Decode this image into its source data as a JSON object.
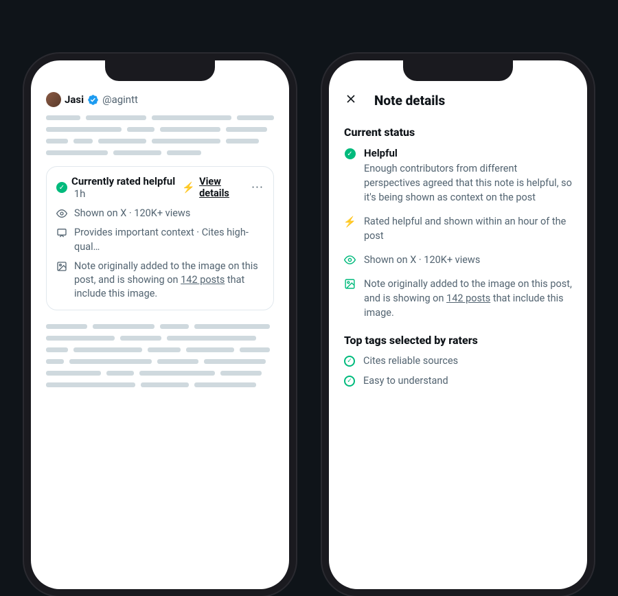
{
  "left": {
    "author": {
      "name": "Jasi",
      "handle": "@agintt"
    },
    "note": {
      "title": "Currently rated helpful",
      "time": "1h",
      "view_details": "View details",
      "shown": "Shown on X · 120K+ views",
      "provides": "Provides important context · Cites high-qual…",
      "originally_pre": "Note originally added to the image on this post, and is showing on ",
      "originally_link": "142 posts",
      "originally_post": " that include this image."
    }
  },
  "right": {
    "title": "Note details",
    "status_heading": "Current status",
    "helpful": {
      "label": "Helpful",
      "text": "Enough contributors from different perspectives agreed that this note is helpful, so it's being shown as context on the post"
    },
    "rated": "Rated helpful and shown within an hour of the post",
    "shown": "Shown on X · 120K+ views",
    "originally_pre": "Note originally added to the image on this post, and is showing on ",
    "originally_link": "142 posts",
    "originally_post": " that include this image.",
    "tags_heading": "Top tags selected by raters",
    "tags": {
      "0": "Cites reliable sources",
      "1": "Easy to understand"
    }
  }
}
